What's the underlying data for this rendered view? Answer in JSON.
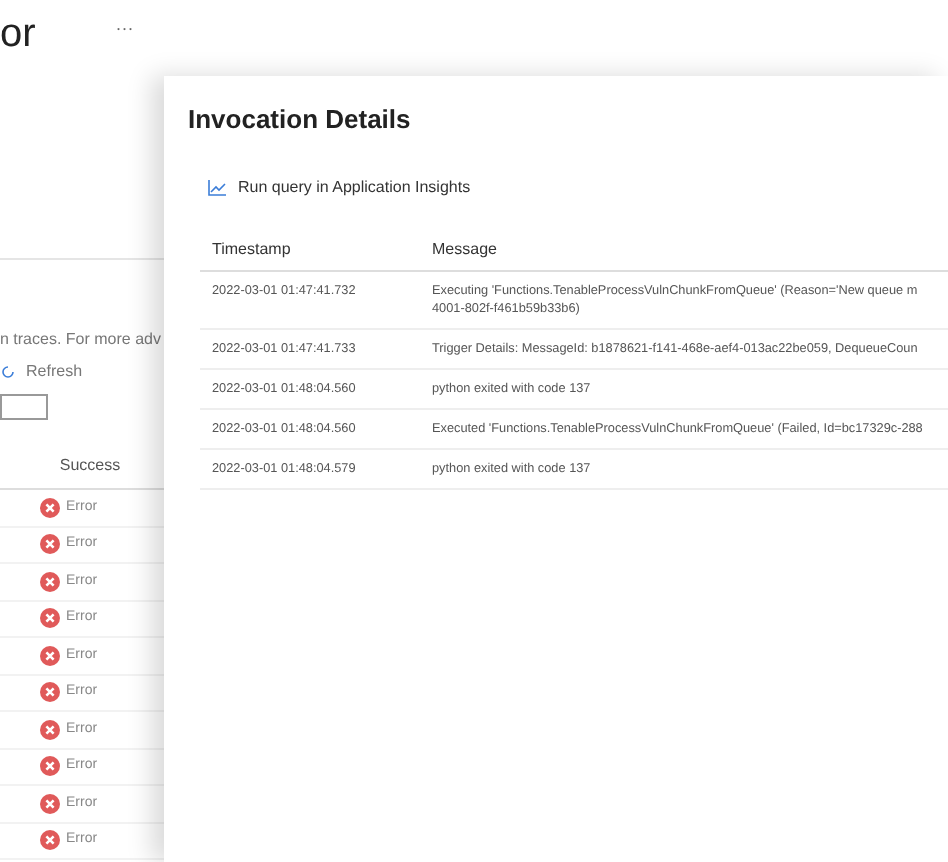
{
  "page": {
    "title": "or",
    "more": "···",
    "note": "n traces. For more adv",
    "refresh": "Refresh",
    "column": "Success",
    "rows": [
      {
        "kind": "error",
        "status": "Error"
      },
      {
        "kind": "error",
        "status": "Error"
      },
      {
        "kind": "error",
        "status": "Error"
      },
      {
        "kind": "error",
        "status": "Error"
      },
      {
        "kind": "error",
        "status": "Error"
      },
      {
        "kind": "error",
        "status": "Error"
      },
      {
        "kind": "error",
        "status": "Error"
      },
      {
        "kind": "error",
        "status": "Error"
      },
      {
        "kind": "error",
        "status": "Error"
      },
      {
        "kind": "error",
        "status": "Error"
      }
    ]
  },
  "panel": {
    "title": "Invocation Details",
    "action": "Run query in Application Insights",
    "columns": [
      "Timestamp",
      "Message"
    ],
    "rows": [
      {
        "timestamp": "2022-03-01 01:47:41.732",
        "message": "Executing 'Functions.TenableProcessVulnChunkFromQueue' (Reason='New queue m",
        "message_line_2": "4001-802f-f461b59b33b6)"
      },
      {
        "timestamp": "2022-03-01 01:47:41.733",
        "message": "Trigger Details: MessageId: b1878621-f141-468e-aef4-013ac22be059, DequeueCoun"
      },
      {
        "timestamp": "2022-03-01 01:48:04.560",
        "message": "python exited with code 137"
      },
      {
        "timestamp": "2022-03-01 01:48:04.560",
        "message": "Executed 'Functions.TenableProcessVulnChunkFromQueue' (Failed, Id=bc17329c-288"
      },
      {
        "timestamp": "2022-03-01 01:48:04.579",
        "message": "python exited with code 137"
      }
    ]
  }
}
